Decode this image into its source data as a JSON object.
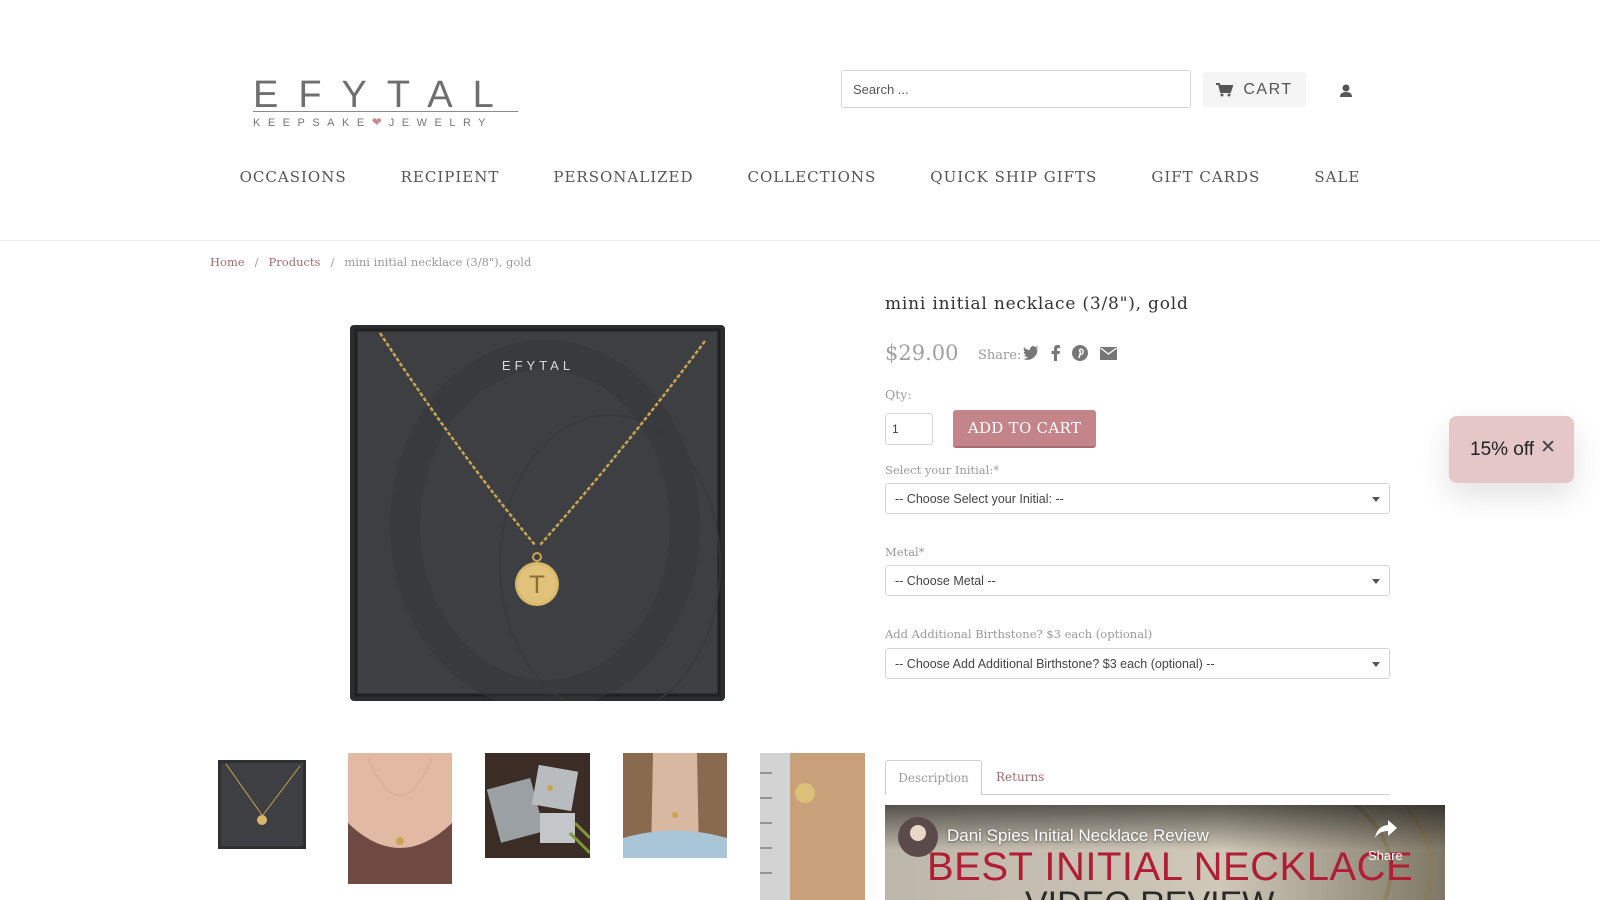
{
  "brand": {
    "name": "EFYTAL",
    "tagline_left": "KEEPSAKE",
    "tagline_right": "JEWELRY",
    "heart_color": "#c98b90"
  },
  "header": {
    "search_placeholder": "Search ...",
    "cart_label": "CART",
    "icons": {
      "cart": "cart-icon",
      "account": "user-icon"
    }
  },
  "nav": {
    "items": [
      "OCCASIONS",
      "RECIPIENT",
      "PERSONALIZED",
      "COLLECTIONS",
      "QUICK SHIP GIFTS",
      "GIFT CARDS",
      "SALE"
    ]
  },
  "breadcrumb": {
    "home": "Home",
    "products": "Products",
    "separator": "/",
    "current": "mini initial necklace (3/8\"), gold"
  },
  "product": {
    "title": "mini initial necklace (3/8\"), gold",
    "price": "$29.00",
    "share_label": "Share:",
    "share_icons": [
      "twitter-icon",
      "facebook-icon",
      "pinterest-icon",
      "email-icon"
    ],
    "qty_label": "Qty:",
    "qty_value": "1",
    "add_to_cart": "ADD TO CART",
    "add_to_cart_color": "#c4858a",
    "image_box_text": "EFYTAL",
    "image_pendant_letter": "T"
  },
  "options": [
    {
      "label": "Select your Initial:*",
      "selected": "-- Choose Select your Initial: --"
    },
    {
      "label": "Metal*",
      "selected": "-- Choose Metal --"
    },
    {
      "label": "Add Additional Birthstone? $3 each (optional)",
      "selected": "-- Choose Add Additional Birthstone? $3 each (optional) --"
    }
  ],
  "promo": {
    "text": "15% off",
    "close": "✕",
    "color": "#e5c7c8"
  },
  "tabs": {
    "description": "Description",
    "returns": "Returns"
  },
  "video": {
    "title": "Dani Spies Initial Necklace Review",
    "headline": "BEST INITIAL NECKLACE",
    "subline": "VIDEO REVIEW",
    "share": "Share"
  }
}
